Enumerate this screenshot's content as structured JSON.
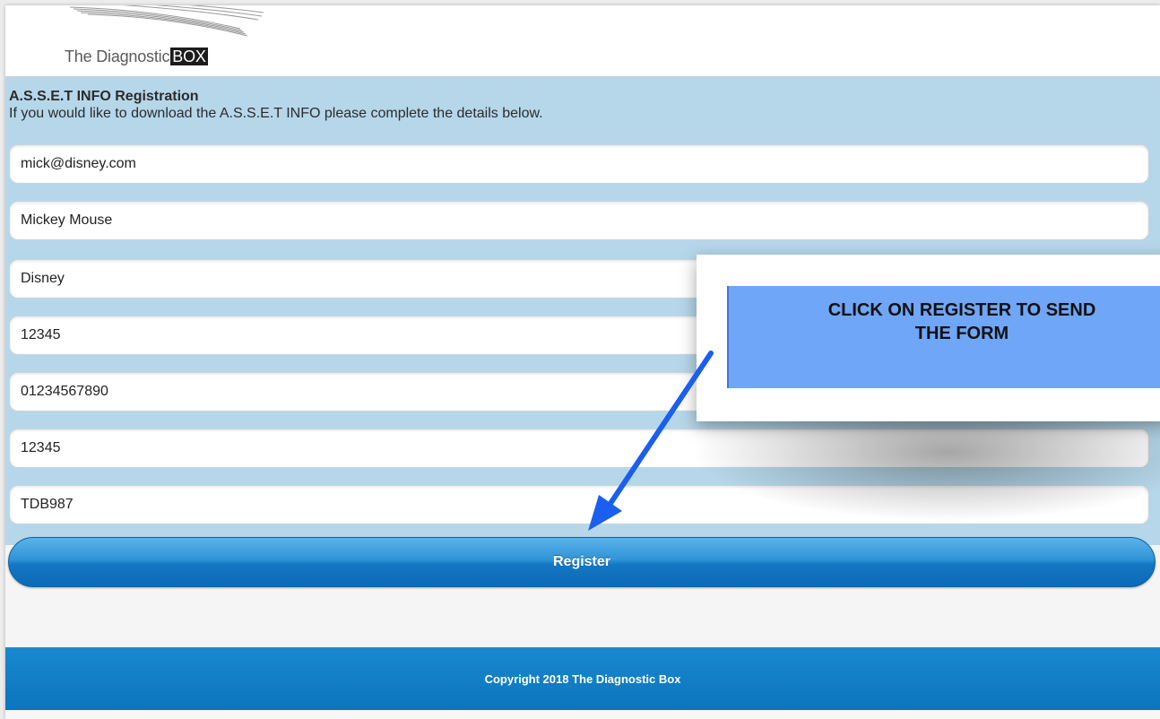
{
  "header": {
    "logo_text": "The Diagnostic",
    "logo_box": "BOX"
  },
  "form": {
    "title": "A.S.S.E.T INFO Registration",
    "description": "If you would like to download the A.S.S.E.T INFO please complete the details below.",
    "fields": [
      {
        "name": "email-field",
        "value": "mick@disney.com"
      },
      {
        "name": "name-field",
        "value": "Mickey Mouse"
      },
      {
        "name": "company-field",
        "value": "Disney"
      },
      {
        "name": "postcode-field",
        "value": "12345"
      },
      {
        "name": "phone-field",
        "value": "01234567890"
      },
      {
        "name": "number-field",
        "value": "12345"
      },
      {
        "name": "code-field",
        "value": "TDB987"
      }
    ],
    "register_label": "Register"
  },
  "footer": {
    "copyright": "Copyright 2018 The Diagnostic Box"
  },
  "annotation": {
    "text": "CLICK ON REGISTER TO SEND\nTHE FORM"
  },
  "colors": {
    "band": "#b6d7ea",
    "button": "#1377c4",
    "footer": "#0b74bd",
    "callout": "#6fa6f7",
    "arrow": "#1a5ff0"
  }
}
